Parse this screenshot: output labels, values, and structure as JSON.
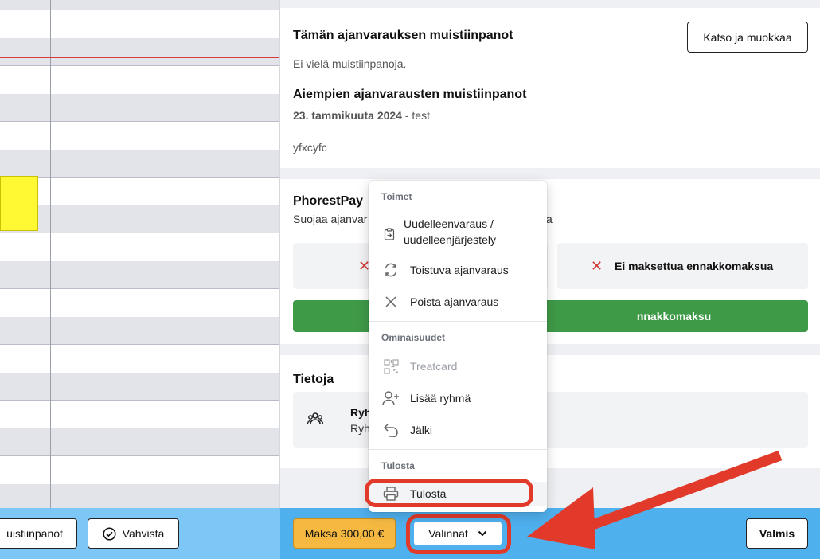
{
  "notes": {
    "title": "Tämän ajanvarauksen muistiinpanot",
    "edit_button": "Katso ja muokkaa",
    "empty_text": "Ei vielä muistiinpanoja.",
    "previous_title": "Aiempien ajanvarausten muistiinpanot",
    "previous_date": "23. tammikuuta 2024",
    "previous_sep": " - ",
    "previous_label": "test",
    "previous_body": "yfxcyfc"
  },
  "phorestpay": {
    "title": "PhorestPay",
    "subtitle_start": "Suojaa ajanvar",
    "subtitle_end": "a",
    "status_right": "Ei maksettua ennakkomaksua",
    "action_button_tail": "nnakkomaksu"
  },
  "info": {
    "title": "Tietoja",
    "row1": "Ryh",
    "row2": "Ryh"
  },
  "menu": {
    "section_actions": "Toimet",
    "reschedule_line1": "Uudelleenvaraus /",
    "reschedule_line2": "uudelleenjärjestely",
    "recurring": "Toistuva ajanvaraus",
    "delete": "Poista ajanvaraus",
    "section_features": "Ominaisuudet",
    "treatcard": "Treatcard",
    "add_group": "Lisää ryhmä",
    "trail": "Jälki",
    "section_print": "Tulosta",
    "print": "Tulosta"
  },
  "footer": {
    "notes_button": "uistiinpanot",
    "confirm_button": "Vahvista",
    "pay_button": "Maksa 300,00 €",
    "options_button": "Valinnat",
    "done_button": "Valmis"
  },
  "colors": {
    "accent_yellow": "#f5b942",
    "footer_blue": "#4fb0ee",
    "green": "#3f9a47",
    "annotation_red": "#e23a2a"
  }
}
